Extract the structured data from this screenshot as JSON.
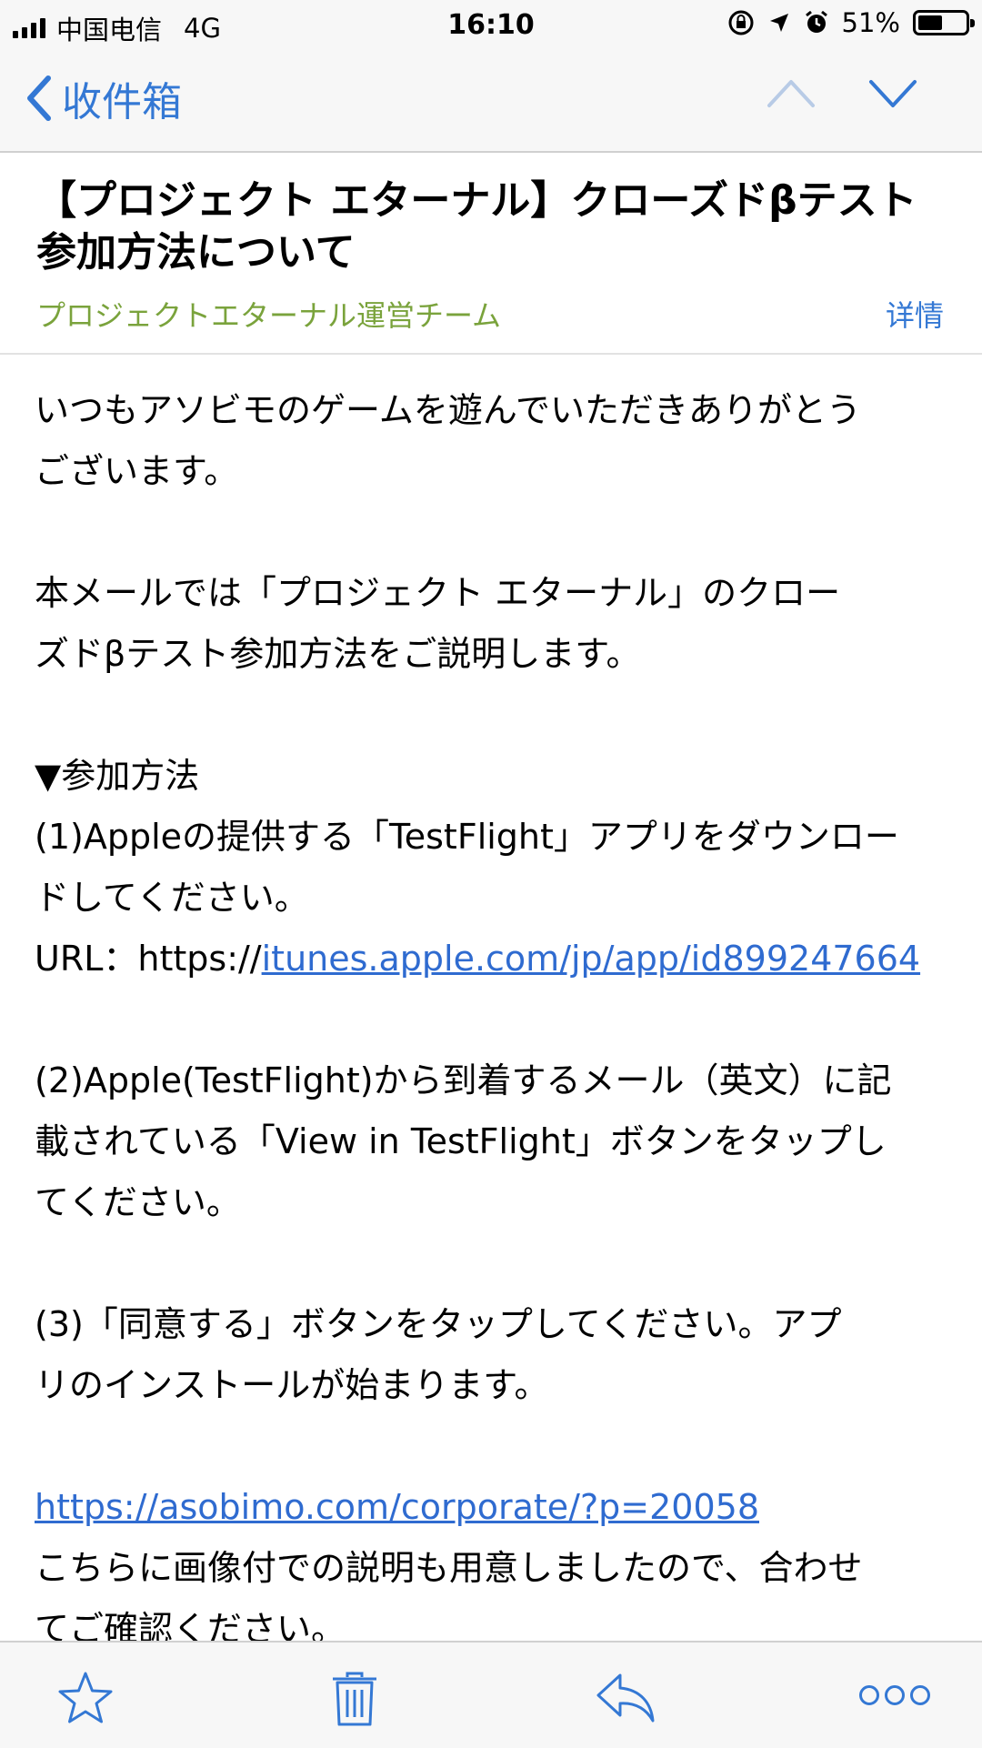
{
  "status_bar": {
    "carrier": "中国电信",
    "network": "4G",
    "time": "16:10",
    "battery_text": "51%",
    "battery_level": 0.51
  },
  "nav": {
    "back_label": "收件箱"
  },
  "email": {
    "subject_line1": "【プロジェクト エターナル】クローズドβテスト",
    "subject_line2": "参加方法について",
    "sender": "プロジェクトエターナル運営チーム",
    "details_label": "详情",
    "body": {
      "greeting_line1": "いつもアソビモのゲームを遊んでいただきありがとう",
      "greeting_line2": "ございます。",
      "intro_line1": "本メールでは「プロジェクト エターナル」のクロー",
      "intro_line2": "ズドβテスト参加方法をご説明します。",
      "section_heading": "▼参加方法",
      "step1_line1": "(1)Appleの提供する「TestFlight」アプリをダウンロー",
      "step1_line2": "ドしてください。",
      "url_label": "URL：https://",
      "url_link": "itunes.apple.com/jp/app/id899247664",
      "step2_line1": "(2)Apple(TestFlight)から到着するメール（英文）に記",
      "step2_line2": "載されている「View in TestFlight」ボタンをタップし",
      "step2_line3": "てください。",
      "step3_line1": "(3)「同意する」ボタンをタップしてください。アプ",
      "step3_line2": "リのインストールが始まります。",
      "corp_link": "https://asobimo.com/corporate/?p=20058",
      "closing_line1": "こちらに画像付での説明も用意しましたので、合わせ",
      "closing_line2": "てご確認ください。"
    }
  },
  "colors": {
    "accent": "#3478d4",
    "sender": "#7aa33c",
    "link": "#2f6bd0"
  },
  "toolbar": {
    "icons": [
      "star-icon",
      "trash-icon",
      "reply-icon",
      "more-icon"
    ]
  }
}
